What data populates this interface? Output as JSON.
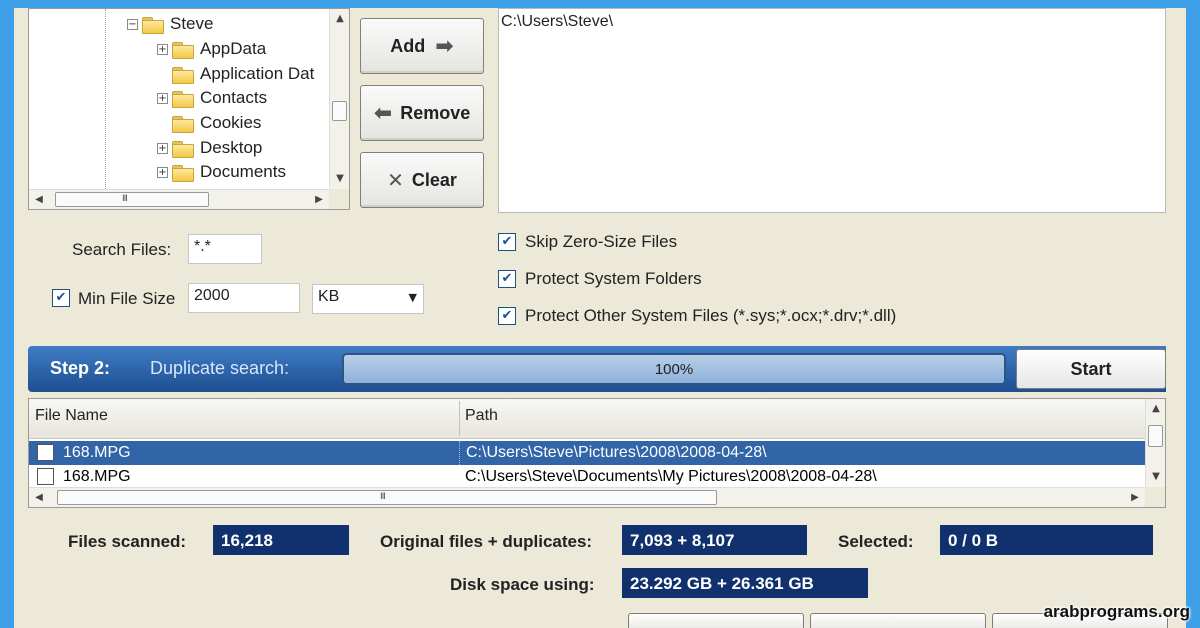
{
  "tree": {
    "items": [
      {
        "label": "Steve",
        "expander": "−"
      },
      {
        "label": "AppData",
        "expander": "+"
      },
      {
        "label": "Application Dat",
        "expander": ""
      },
      {
        "label": "Contacts",
        "expander": "+"
      },
      {
        "label": "Cookies",
        "expander": ""
      },
      {
        "label": "Desktop",
        "expander": "+"
      },
      {
        "label": "Documents",
        "expander": "+"
      }
    ],
    "grip": "III"
  },
  "buttons": {
    "add": "Add",
    "remove": "Remove",
    "clear": "Clear"
  },
  "path_list": {
    "items": [
      "C:\\Users\\Steve\\"
    ]
  },
  "options": {
    "search_files_label": "Search Files:",
    "search_files_value": "*.*",
    "min_file_size_label": "Min File Size",
    "min_file_size_checked": true,
    "min_file_size_value": "2000",
    "unit_value": "KB",
    "skip_zero": "Skip Zero-Size Files",
    "protect_system_folders": "Protect System Folders",
    "protect_other": "Protect Other System Files (*.sys;*.ocx;*.drv;*.dll)"
  },
  "step": {
    "title": "Step 2:",
    "subtitle": "Duplicate search:",
    "progress_text": "100%",
    "progress_fraction": 1.0,
    "start_label": "Start"
  },
  "results": {
    "columns": [
      "File Name",
      "Path"
    ],
    "rows": [
      {
        "name": "168.MPG",
        "path": "C:\\Users\\Steve\\Pictures\\2008\\2008-04-28\\",
        "selected": true
      },
      {
        "name": "168.MPG",
        "path": "C:\\Users\\Steve\\Documents\\My Pictures\\2008\\2008-04-28\\",
        "selected": false
      }
    ],
    "grip": "III"
  },
  "stats": {
    "files_scanned_label": "Files scanned:",
    "files_scanned_value": "16,218",
    "originals_label": "Original files + duplicates:",
    "originals_value": "7,093 + 8,107",
    "selected_label": "Selected:",
    "selected_value": "0 / 0 B",
    "disk_label": "Disk space using:",
    "disk_value": "23.292 GB + 26.361 GB"
  },
  "watermark": "arabprograms.org",
  "colors": {
    "accent_blue": "#1d4f91",
    "stat_box": "#10306e",
    "selection": "#3165a7",
    "background": "#3da0e6"
  }
}
